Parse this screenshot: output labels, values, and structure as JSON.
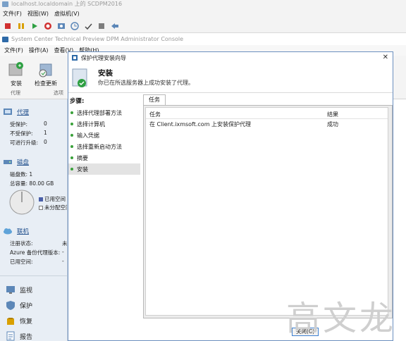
{
  "vm": {
    "title": "localhost.localdomain 上的 SCDPM2016",
    "menu": [
      "文件(F)",
      "视图(W)",
      "虚拟机(V)"
    ],
    "toolbar_icons": [
      "stop-icon",
      "pause-icon",
      "play-icon",
      "reset-icon",
      "snapshot-icon",
      "revert-icon",
      "settings-icon",
      "power-icon",
      "send-keys-icon"
    ]
  },
  "app": {
    "title": "System Center Technical Preview DPM Administrator Console",
    "menu": [
      "文件(F)",
      "操作(A)",
      "查看(V)",
      "帮助(H)"
    ],
    "ribbon": {
      "install_label": "安装",
      "check_update_label": "检查更新",
      "group_agent": "代理",
      "group_options": "选项"
    }
  },
  "nav": {
    "agents": {
      "title": "代理",
      "rows": [
        {
          "label": "受保护:",
          "value": "0"
        },
        {
          "label": "不受保护:",
          "value": "1"
        },
        {
          "label": "可进行升级:",
          "value": "0"
        }
      ]
    },
    "disks": {
      "title": "磁盘",
      "count_label": "磁盘数:",
      "count_value": "1",
      "capacity_label": "总容量:",
      "capacity_value": "80.00 GB",
      "legend_used": "已用空间",
      "legend_unalloc": "未分配空间"
    },
    "online": {
      "title": "联机",
      "rows": [
        {
          "label": "注册状态:",
          "value": "未"
        },
        {
          "label": "Azure 备份代理版本:",
          "value": "-"
        },
        {
          "label": "已用空间:",
          "value": "-"
        }
      ]
    },
    "workspaces": [
      "监视",
      "保护",
      "恢复",
      "报告"
    ]
  },
  "dialog": {
    "title": "保护代理安装向导",
    "header_title": "安装",
    "header_subtitle": "你已在所选服务器上成功安装了代理。",
    "steps_title": "步骤:",
    "steps": [
      "选择代理部署方法",
      "选择计算机",
      "输入凭据",
      "选择重新启动方法",
      "摘要",
      "安装"
    ],
    "active_step_index": 5,
    "tab_label": "任务",
    "columns": [
      "任务",
      "结果"
    ],
    "rows": [
      {
        "task": "在 Client.ixmsoft.com 上安装保护代理",
        "result": "成功"
      }
    ],
    "close_label": "关闭(C)"
  },
  "watermark": "高文龙",
  "colors": {
    "accent": "#1f4e8c",
    "nav_bg": "#e8eef5",
    "step_dot": "#3aa13a",
    "dialog_border": "#6b8fbf"
  }
}
